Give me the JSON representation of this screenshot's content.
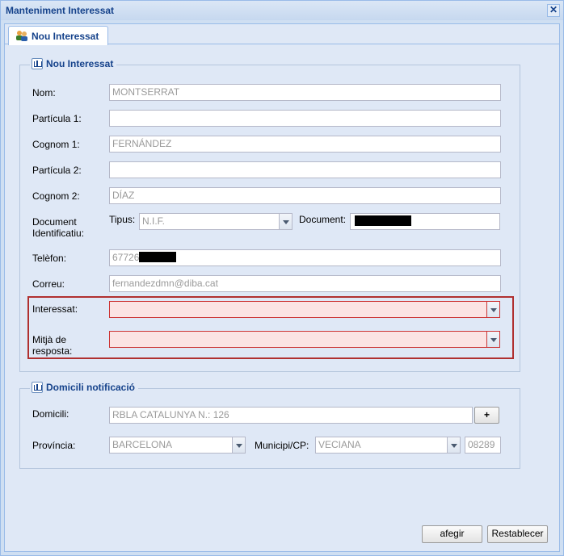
{
  "window": {
    "title": "Manteniment Interessat",
    "close_symbol": "✕"
  },
  "tab": {
    "label": "Nou Interessat",
    "icon": "users-icon"
  },
  "section_interessat": {
    "legend": "Nou Interessat",
    "nom_label": "Nom:",
    "nom_value": "MONTSERRAT",
    "particula1_label": "Partícula 1:",
    "particula1_value": "",
    "cognom1_label": "Cognom 1:",
    "cognom1_value": "FERNÁNDEZ",
    "particula2_label": "Partícula 2:",
    "particula2_value": "",
    "cognom2_label": "Cognom 2:",
    "cognom2_value": "DÍAZ",
    "document_label_line1": "Document",
    "document_label_line2": "Identificatiu:",
    "tipus_label": "Tipus:",
    "tipus_value": "N.I.F.",
    "document_field_label": "Document:",
    "document_value": "",
    "telefon_label": "Telèfon:",
    "telefon_value": "67726",
    "correu_label": "Correu:",
    "correu_value": "fernandezdmn@diba.cat",
    "interessat_label": "Interessat:",
    "interessat_value": "",
    "mitja_label_line1": "Mitjà de",
    "mitja_label_line2": "resposta:",
    "mitja_value": ""
  },
  "section_domicili": {
    "legend": "Domicili notificació",
    "domicili_label": "Domicili:",
    "domicili_value": "RBLA CATALUNYA N.: 126",
    "plus_label": "+",
    "provincia_label": "Província:",
    "provincia_value": "BARCELONA",
    "municipi_label": "Municipi/CP:",
    "municipi_value": "VECIANA",
    "cp_value": "08289"
  },
  "buttons": {
    "afegir": "afegir",
    "restablecer": "Restablecer"
  },
  "colors": {
    "accent": "#15428b",
    "panel": "#dfe8f6",
    "invalid_bg": "#fbe3e3",
    "highlight": "#b03030"
  }
}
